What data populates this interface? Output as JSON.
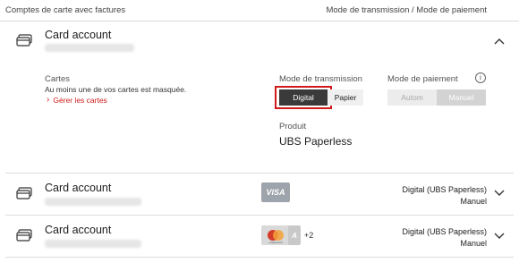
{
  "header": {
    "left": "Comptes de carte avec factures",
    "right": "Mode de transmission / Mode de paiement"
  },
  "expanded_account": {
    "title": "Card account",
    "cards_label": "Cartes",
    "cards_note": "Au moins une de vos cartes est masquée.",
    "manage_link": "Gérer les cartes",
    "transmission_label": "Mode de transmission",
    "transmission_options": [
      "Digital",
      "Papier"
    ],
    "transmission_selected": "Digital",
    "payment_label": "Mode de paiement",
    "payment_options": [
      "Autom",
      "Manuel"
    ],
    "payment_selected": "Manuel",
    "info_icon": "i",
    "product_label": "Produit",
    "product_value": "UBS Paperless"
  },
  "accounts": [
    {
      "title": "Card account",
      "brand": "VISA",
      "transmission": "Digital (UBS Paperless)",
      "payment": "Manuel"
    },
    {
      "title": "Card account",
      "brand": "mastercard",
      "extra_count": "+2",
      "transmission": "Digital (UBS Paperless)",
      "payment": "Manuel"
    }
  ],
  "colors": {
    "selected_bg": "#3a3a3a",
    "highlight_border": "#d11a1a",
    "link_red": "#d11a1a",
    "toggle_bg": "#e8e8e8",
    "visa_bg": "#9ea4ab"
  }
}
